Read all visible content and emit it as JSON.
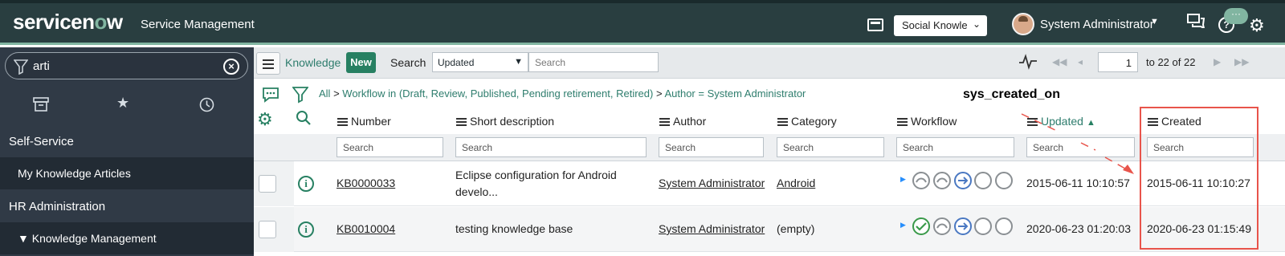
{
  "app": {
    "logo_text_a": "servicen",
    "logo_text_o": "o",
    "logo_text_b": "w",
    "title": "Service Management",
    "scope_select": "Social Knowle",
    "user_name": "System Administrator",
    "bubble_text": "···",
    "help_text": "?"
  },
  "sidebar": {
    "filter_value": "arti",
    "clear_text": "×",
    "sections": [
      {
        "label": "Self-Service"
      },
      {
        "label": "HR Administration"
      }
    ],
    "items": [
      {
        "label": "My Knowledge Articles"
      },
      {
        "label": "Knowledge Management"
      }
    ],
    "expand_glyph": "▼"
  },
  "list": {
    "title": "Knowledge",
    "new_label": "New",
    "search_label": "Search",
    "search_field": "Updated",
    "search_placeholder": "Search",
    "page_input": "1",
    "page_total": "to 22 of 22",
    "breadcrumbs": {
      "all": "All",
      "sep": ">",
      "crumb1": "Workflow in (Draft, Review, Published, Pending retirement, Retired)",
      "crumb2": "Author = System Administrator"
    },
    "annotation": "sys_created_on",
    "columns": [
      {
        "label": "Number"
      },
      {
        "label": "Short description"
      },
      {
        "label": "Author"
      },
      {
        "label": "Category"
      },
      {
        "label": "Workflow"
      },
      {
        "label": "Updated"
      },
      {
        "label": "Created"
      }
    ],
    "column_search_placeholder": "Search",
    "rows": [
      {
        "number": "KB0000033",
        "short_desc_line1": "Eclipse configuration for Android",
        "short_desc_line2": "develo...",
        "author": "System Administrator",
        "category": "Android",
        "updated": "2015-06-11 10:10:57",
        "created": "2015-06-11 10:10:27"
      },
      {
        "number": "KB0010004",
        "short_desc_line1": "testing knowledge base",
        "short_desc_line2": "",
        "author": "System Administrator",
        "category": "(empty)",
        "updated": "2020-06-23 01:20:03",
        "created": "2020-06-23 01:15:49"
      }
    ]
  },
  "colors": {
    "header_bg": "#293e40",
    "accent": "#81b5a1",
    "link_green": "#2e7d6d",
    "new_button": "#278062",
    "highlight": "#e8544b"
  },
  "icons": {
    "window": "window-icon",
    "chat": "chat-icon",
    "help": "help-icon",
    "settings": "gear-icon",
    "filter": "funnel-icon",
    "archive": "archive-icon",
    "favorites": "star-icon",
    "history": "clock-icon",
    "activity": "pulse-icon",
    "info": "info-icon",
    "search": "search-icon"
  }
}
